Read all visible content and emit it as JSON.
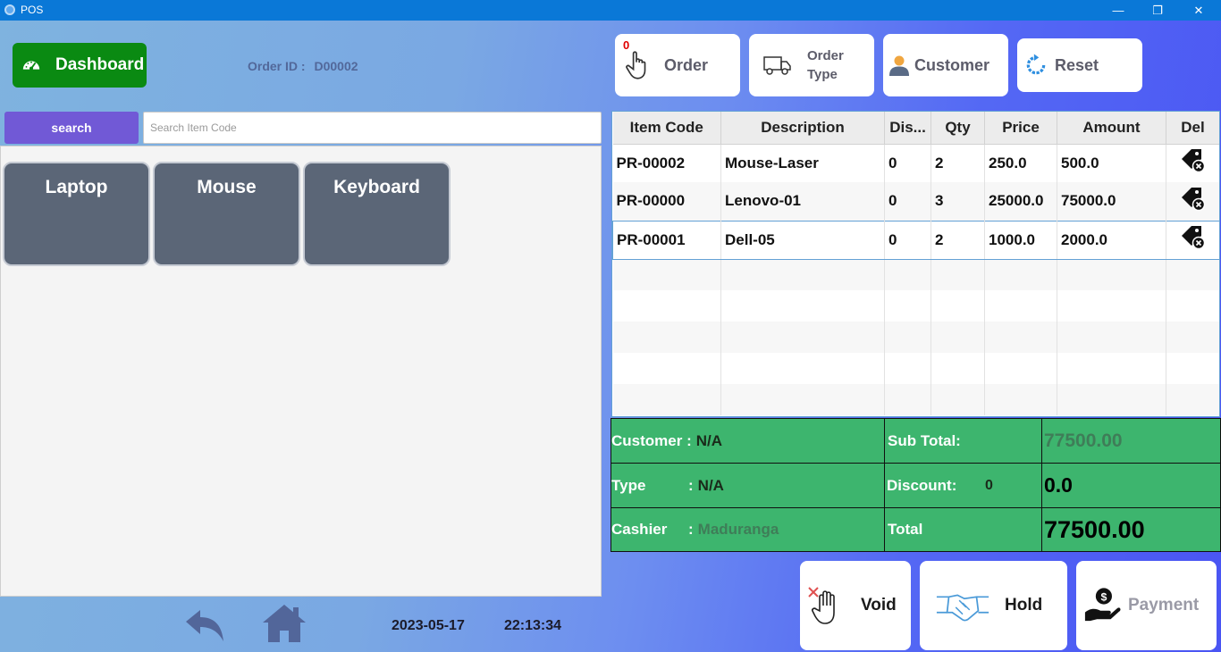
{
  "window": {
    "title": "POS",
    "minimize": "—",
    "restore": "❐",
    "close": "✕"
  },
  "dashboard": {
    "label": "Dashboard"
  },
  "order": {
    "id_label": "Order ID :",
    "id_value": "D00002"
  },
  "search": {
    "button_label": "search",
    "placeholder": "Search Item Code"
  },
  "categories": [
    "Laptop",
    "Mouse",
    "Keyboard"
  ],
  "footer": {
    "date": "2023-05-17",
    "time": "22:13:34"
  },
  "top_buttons": {
    "order_label": "Order",
    "order_count": "0",
    "order_type_line1": "Order",
    "order_type_line2": "Type",
    "customer_label": "Customer",
    "reset_label": "Reset"
  },
  "table": {
    "headers": [
      "Item Code",
      "Description",
      "Dis...",
      "Qty",
      "Price",
      "Amount",
      "Del"
    ],
    "rows": [
      [
        "PR-00002",
        "Mouse-Laser",
        "0",
        "2",
        "250.0",
        "500.0"
      ],
      [
        "PR-00000",
        "Lenovo-01",
        "0",
        "3",
        "25000.0",
        "75000.0"
      ],
      [
        "PR-00001",
        "Dell-05",
        "0",
        "2",
        "1000.0",
        "2000.0"
      ]
    ]
  },
  "summary": {
    "customer_label": "Customer :",
    "customer_value": "N/A",
    "type_label": "Type",
    "type_colon": ":",
    "type_value": "N/A",
    "cashier_label": "Cashier",
    "cashier_colon": ":",
    "cashier_value": "Maduranga",
    "subtotal_label": "Sub Total:",
    "subtotal_value": "77500.00",
    "discount_label": "Discount:",
    "discount_percent": "0",
    "discount_value": "0.0",
    "total_label": "Total",
    "total_value": "77500.00"
  },
  "actions": {
    "void_label": "Void",
    "hold_label": "Hold",
    "payment_label": "Payment"
  },
  "colors": {
    "title_bar": "#0a78d7",
    "dashboard": "#0a8a12",
    "search_button": "#7159d6",
    "category_tile": "#5b6677",
    "summary_green": "#3db56e",
    "order_badge": "#e00000"
  }
}
